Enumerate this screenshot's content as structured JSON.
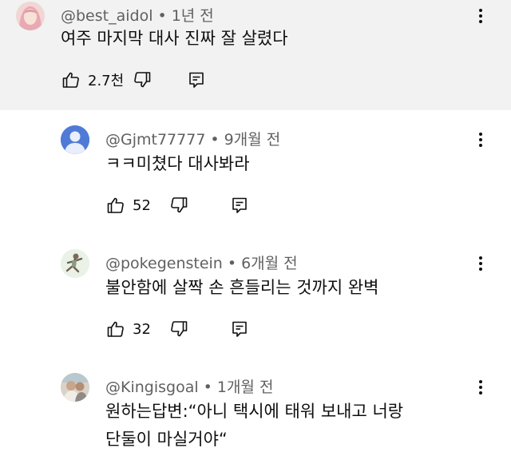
{
  "comments": [
    {
      "author": "@best_aidol",
      "time": "1년 전",
      "text": "여주 마지막 대사 진짜 잘 살렸다",
      "likes": "2.7천",
      "highlighted": true
    },
    {
      "author": "@Gjmt77777",
      "time": "9개월 전",
      "text": "ㅋㅋ미쳤다 대사봐라",
      "likes": "52"
    },
    {
      "author": "@pokegenstein",
      "time": "6개월 전",
      "text": "불안함에 살짝 손 흔들리는 것까지 완벽",
      "likes": "32"
    },
    {
      "author": "@Kingisgoal",
      "time": "1개월 전",
      "text_line1": "원하는답변:“아니 택시에 태워 보내고 너랑",
      "text_line2": "단둘이 마실거야“"
    }
  ],
  "meta_separator": "•",
  "colors": {
    "highlight_bg": "#f2f2f2",
    "meta": "#606060",
    "text": "#0f0f0f",
    "default_avatar": "#4f7bd6"
  }
}
